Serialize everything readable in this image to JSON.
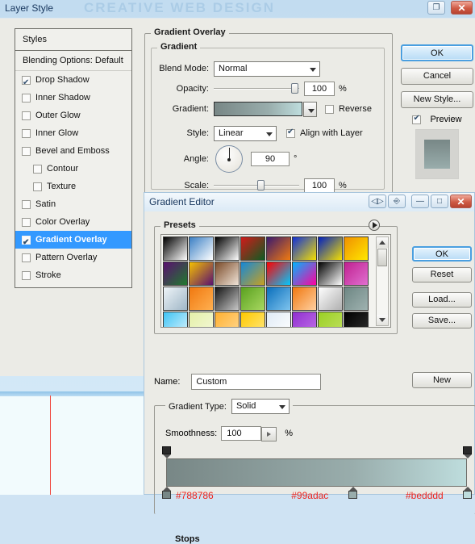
{
  "desktop": {
    "banner_text": "CREATIVE WEB DESIGN"
  },
  "layer_style": {
    "title": "Layer Style",
    "window_buttons": [
      {
        "name": "restore-icon",
        "glyph": "❐"
      },
      {
        "name": "close-icon",
        "glyph": "✕"
      }
    ],
    "styles_panel": {
      "header": "Styles",
      "blending_options": "Blending Options: Default",
      "items": [
        {
          "label": "Drop Shadow",
          "checked": true,
          "selected": false,
          "indent": false
        },
        {
          "label": "Inner Shadow",
          "checked": false,
          "selected": false,
          "indent": false
        },
        {
          "label": "Outer Glow",
          "checked": false,
          "selected": false,
          "indent": false
        },
        {
          "label": "Inner Glow",
          "checked": false,
          "selected": false,
          "indent": false
        },
        {
          "label": "Bevel and Emboss",
          "checked": false,
          "selected": false,
          "indent": false
        },
        {
          "label": "Contour",
          "checked": false,
          "selected": false,
          "indent": true
        },
        {
          "label": "Texture",
          "checked": false,
          "selected": false,
          "indent": true
        },
        {
          "label": "Satin",
          "checked": false,
          "selected": false,
          "indent": false
        },
        {
          "label": "Color Overlay",
          "checked": false,
          "selected": false,
          "indent": false
        },
        {
          "label": "Gradient Overlay",
          "checked": true,
          "selected": true,
          "indent": false
        },
        {
          "label": "Pattern Overlay",
          "checked": false,
          "selected": false,
          "indent": false
        },
        {
          "label": "Stroke",
          "checked": false,
          "selected": false,
          "indent": false
        }
      ]
    },
    "gradient_overlay": {
      "group_title": "Gradient Overlay",
      "subgroup_title": "Gradient",
      "blend_mode_label": "Blend Mode:",
      "blend_mode_value": "Normal",
      "opacity_label": "Opacity:",
      "opacity_value": "100",
      "opacity_unit": "%",
      "gradient_label": "Gradient:",
      "reverse_label": "Reverse",
      "reverse_checked": false,
      "style_label": "Style:",
      "style_value": "Linear",
      "align_label": "Align with Layer",
      "align_checked": true,
      "angle_label": "Angle:",
      "angle_value": "90",
      "angle_unit": "°",
      "scale_label": "Scale:",
      "scale_value": "100",
      "scale_unit": "%"
    },
    "buttons": [
      {
        "label": "OK",
        "primary": true
      },
      {
        "label": "Cancel",
        "primary": false
      },
      {
        "label": "New Style...",
        "primary": false
      }
    ],
    "preview_label": "Preview",
    "preview_checked": true
  },
  "gradient_editor": {
    "title": "Gradient Editor",
    "window_buttons": [
      {
        "name": "dock-left-right-icon",
        "glyph": "◁▷"
      },
      {
        "name": "panel-menu-icon",
        "glyph": "⎆"
      },
      {
        "name": "minimize-icon",
        "glyph": "—"
      },
      {
        "name": "maximize-icon",
        "glyph": "□"
      },
      {
        "name": "close-icon",
        "glyph": "✕"
      }
    ],
    "presets_label": "Presets",
    "buttons": [
      {
        "label": "OK",
        "primary": true
      },
      {
        "label": "Reset",
        "primary": false
      },
      {
        "label": "Load...",
        "primary": false
      },
      {
        "label": "Save...",
        "primary": false
      }
    ],
    "new_button": "New",
    "name_label": "Name:",
    "name_value": "Custom",
    "gradient_type_label": "Gradient Type:",
    "gradient_type_value": "Solid",
    "smoothness_label": "Smoothness:",
    "smoothness_value": "100",
    "smoothness_unit": "%",
    "stops_label": "Stops",
    "color_stops": [
      {
        "hex": "#788786",
        "position": 0
      },
      {
        "hex": "#99adac",
        "position": 62
      },
      {
        "hex": "#bedddd",
        "position": 100
      }
    ],
    "presets": [
      [
        "#000000",
        "#ffffff"
      ],
      [
        "#3a7fc4",
        "#ffffff"
      ],
      [
        "#000000",
        "#ffffff"
      ],
      [
        "#d21a1a",
        "#0d5c22"
      ],
      [
        "#3a1a6e",
        "#f07a10"
      ],
      [
        "#1030d8",
        "#f5e000"
      ],
      [
        "#0020c0",
        "#f5e000"
      ],
      [
        "#f09000",
        "#ffe800"
      ],
      [
        "#5a1070",
        "#1f7a2e"
      ],
      [
        "#f5c000",
        "#5a1070"
      ],
      [
        "#7a4a28",
        "#f0e4d8"
      ],
      [
        "#1488d8",
        "#c8a020"
      ],
      [
        "#ff0000",
        "#00c8ff"
      ],
      [
        "#00b4ff",
        "#ff00a0"
      ],
      [
        "#000000",
        "#ffffff"
      ],
      [
        "#c02090",
        "#e070d0"
      ],
      [
        "#eef4f8",
        "#9fb6c6"
      ],
      [
        "#f07810",
        "#ffb050"
      ],
      [
        "#141414",
        "#c8c8c8"
      ],
      [
        "#5aa020",
        "#a8d860"
      ],
      [
        "#0a6fbc",
        "#7fc4ee"
      ],
      [
        "#f07810",
        "#ffd0a0"
      ],
      [
        "#ffffff",
        "#b0b0b0"
      ],
      [
        "#6d8683",
        "#9fb2b0"
      ],
      [
        "#3fc4f5",
        "#d8f2fc"
      ],
      [
        "#e4f0a8",
        "#f4f8d8"
      ],
      [
        "#ffb030",
        "#ffd890"
      ],
      [
        "#ffc800",
        "#ffe880"
      ],
      [
        "#dfeaf5",
        "#ffffff"
      ],
      [
        "#9030d0",
        "#c070e8"
      ],
      [
        "#9ad024",
        "#c0e060"
      ],
      [
        "#000000",
        "#303030"
      ]
    ]
  }
}
